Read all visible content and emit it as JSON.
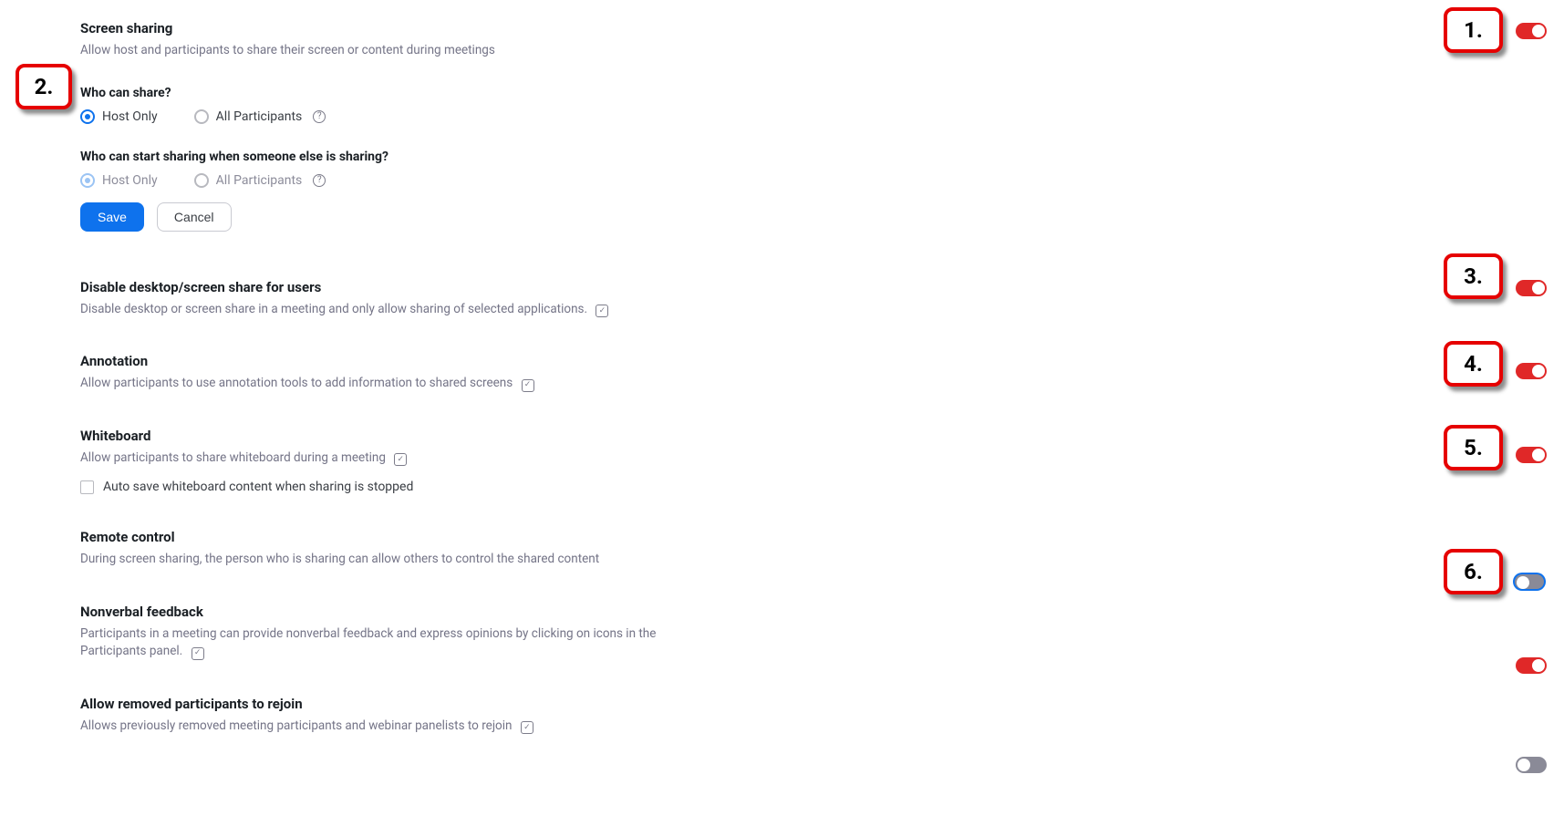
{
  "settings": {
    "screen_sharing": {
      "title": "Screen sharing",
      "desc": "Allow host and participants to share their screen or content during meetings",
      "q1": {
        "label": "Who can share?",
        "opt_host": "Host Only",
        "opt_all": "All Participants"
      },
      "q2": {
        "label": "Who can start sharing when someone else is sharing?",
        "opt_host": "Host Only",
        "opt_all": "All Participants"
      },
      "save": "Save",
      "cancel": "Cancel"
    },
    "disable_desktop": {
      "title": "Disable desktop/screen share for users",
      "desc": "Disable desktop or screen share in a meeting and only allow sharing of selected applications."
    },
    "annotation": {
      "title": "Annotation",
      "desc": "Allow participants to use annotation tools to add information to shared screens"
    },
    "whiteboard": {
      "title": "Whiteboard",
      "desc": "Allow participants to share whiteboard during a meeting",
      "checkbox": "Auto save whiteboard content when sharing is stopped"
    },
    "remote_control": {
      "title": "Remote control",
      "desc": "During screen sharing, the person who is sharing can allow others to control the shared content"
    },
    "nonverbal": {
      "title": "Nonverbal feedback",
      "desc": "Participants in a meeting can provide nonverbal feedback and express opinions by clicking on icons in the Participants panel."
    },
    "rejoin": {
      "title": "Allow removed participants to rejoin",
      "desc": "Allows previously removed meeting participants and webinar panelists to rejoin"
    }
  },
  "annotations": {
    "a1": "1.",
    "a2": "2.",
    "a3": "3.",
    "a4": "4.",
    "a5": "5.",
    "a6": "6."
  }
}
